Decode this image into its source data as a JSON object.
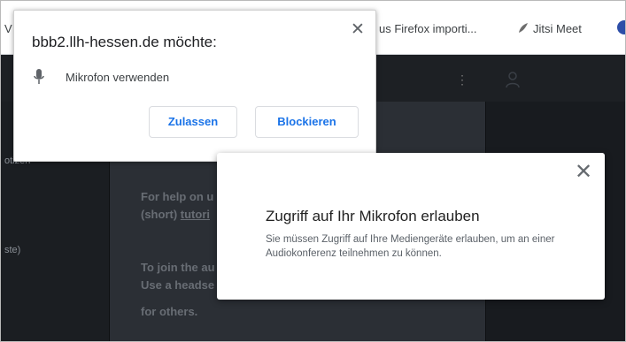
{
  "bookmarks": {
    "left_partial": "V",
    "firefox_label": "us Firefox importi...",
    "jitsi_label": "Jitsi Meet"
  },
  "permission_prompt": {
    "title": "bbb2.llh-hessen.de möchte:",
    "request": "Mikrofon verwenden",
    "allow_label": "Zulassen",
    "block_label": "Blockieren",
    "close_glyph": "✕"
  },
  "app": {
    "sidebar_label_1": "otizen",
    "sidebar_label_2": "ste)",
    "help_line_1": "For help on u",
    "help_line_2_prefix": "(short) ",
    "help_line_2_link": "tutori",
    "join_line_1": "To join the au",
    "join_line_2": "Use a headse",
    "join_line_3": "for others."
  },
  "modal": {
    "close_glyph": "✕",
    "title": "Zugriff auf Ihr Mikrofon erlauben",
    "description": "Sie müssen Zugriff auf Ihre Mediengeräte erlauben, um an einer Audiokonferenz teilnehmen zu können."
  },
  "colors": {
    "accent_blue": "#1a73e8",
    "app_background": "#2b2f35"
  }
}
